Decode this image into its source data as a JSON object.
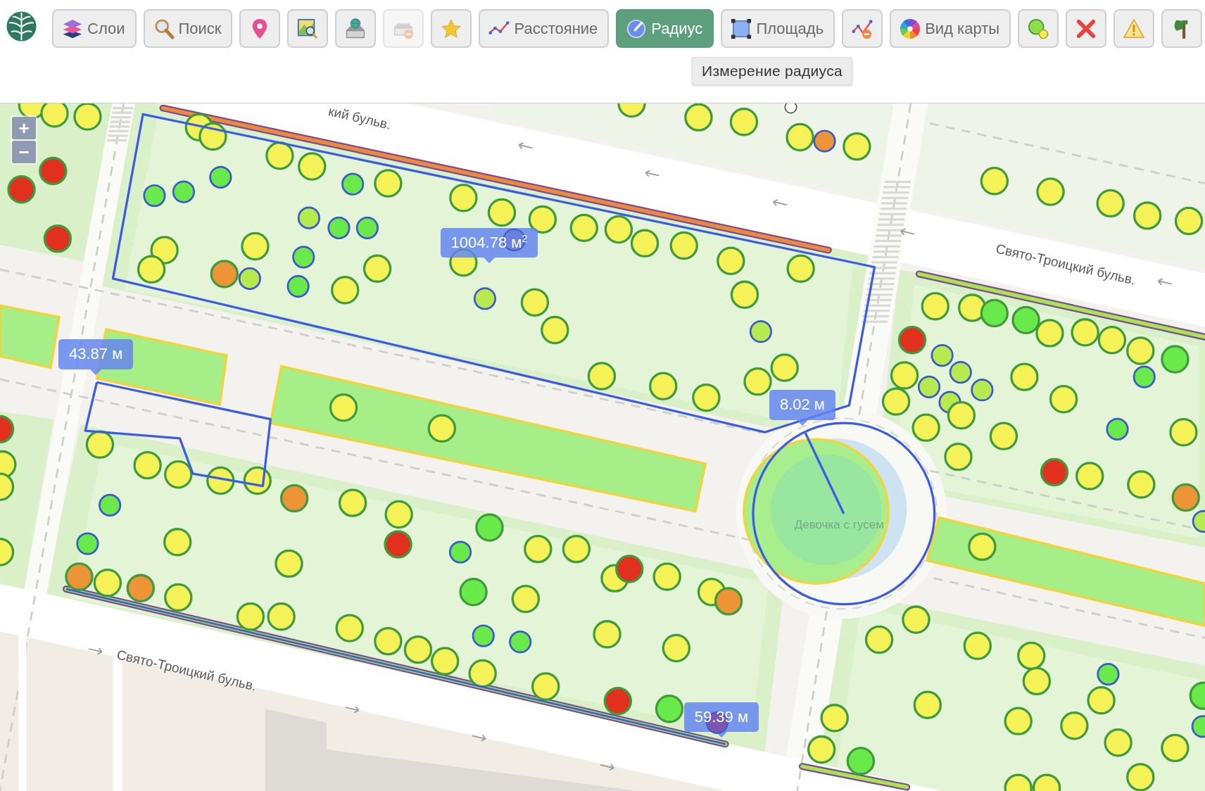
{
  "toolbar": {
    "buttons": [
      {
        "label": "Слои",
        "selected": false,
        "disabled": false
      },
      {
        "label": "Поиск",
        "selected": false,
        "disabled": false
      },
      {
        "selected": false,
        "disabled": false
      },
      {
        "selected": false,
        "disabled": false
      },
      {
        "selected": false,
        "disabled": false
      },
      {
        "selected": false,
        "disabled": true
      },
      {
        "selected": false,
        "disabled": false
      },
      {
        "label": "Расстояние",
        "selected": false,
        "disabled": false
      },
      {
        "label": "Радиус",
        "selected": true,
        "disabled": false
      },
      {
        "label": "Площадь",
        "selected": false,
        "disabled": false
      },
      {
        "selected": false,
        "disabled": false
      },
      {
        "label": "Вид карты",
        "selected": false,
        "disabled": false
      },
      {
        "selected": false,
        "disabled": false
      },
      {
        "selected": false,
        "disabled": false
      },
      {
        "selected": false,
        "disabled": false
      },
      {
        "selected": false,
        "disabled": false
      }
    ]
  },
  "tooltip": {
    "text": "Измерение радиуса"
  },
  "map": {
    "zoom_controls": [
      "+",
      "−"
    ],
    "street_labels": [
      "кий бульв.",
      "Свято-Троицкий бульв.",
      "Свято-Троицкий бульв."
    ],
    "place_label": "Девочка с гусем",
    "measurements": [
      {
        "kind": "area",
        "label": "1004.78 м$^{2}$"
      },
      {
        "kind": "distance",
        "label": "43.87 м"
      },
      {
        "kind": "radius",
        "label": "8.02 м"
      },
      {
        "kind": "distance",
        "label": "59.39 м"
      }
    ],
    "markers": [
      {
        "kind": "large",
        "color": "#f4f257"
      },
      {
        "kind": "large",
        "color": "#f4f257"
      },
      {
        "kind": "large",
        "color": "#f4f257"
      },
      {
        "kind": "large",
        "color": "#e2301f"
      },
      {
        "kind": "large",
        "color": "#e2301f"
      },
      {
        "kind": "large",
        "color": "#e2301f"
      },
      {
        "kind": "large",
        "color": "#e2301f"
      },
      {
        "kind": "large",
        "color": "#f4f257"
      },
      {
        "kind": "large",
        "color": "#f4f257"
      },
      {
        "kind": "large",
        "color": "#f4f257"
      },
      {
        "kind": "large",
        "color": "#f4f257"
      },
      {
        "kind": "large",
        "color": "#f4f257"
      },
      {
        "kind": "large",
        "color": "#f4f257"
      },
      {
        "kind": "large",
        "color": "#f4f257"
      },
      {
        "kind": "large",
        "color": "#f4f257"
      },
      {
        "kind": "large",
        "color": "#ec9436"
      },
      {
        "kind": "small",
        "color": "#6aea4a"
      },
      {
        "kind": "small",
        "color": "#6aea4a"
      },
      {
        "kind": "large",
        "color": "#f4f257"
      },
      {
        "kind": "large",
        "color": "#ec9436"
      },
      {
        "kind": "large",
        "color": "#f4f257"
      },
      {
        "kind": "large",
        "color": "#ec9436"
      },
      {
        "kind": "large",
        "color": "#f4f257"
      },
      {
        "kind": "large",
        "color": "#f4f257"
      },
      {
        "kind": "large",
        "color": "#f4f257"
      },
      {
        "kind": "large",
        "color": "#f4f257"
      },
      {
        "kind": "large",
        "color": "#f4f257"
      },
      {
        "kind": "large",
        "color": "#f4f257"
      },
      {
        "kind": "large",
        "color": "#e2301f"
      },
      {
        "kind": "large",
        "color": "#6aea4a"
      },
      {
        "kind": "small",
        "color": "#6aea4a"
      },
      {
        "kind": "large",
        "color": "#f4f257"
      },
      {
        "kind": "large",
        "color": "#f4f257"
      },
      {
        "kind": "large",
        "color": "#6aea4a"
      },
      {
        "kind": "large",
        "color": "#f4f257"
      },
      {
        "kind": "large",
        "color": "#f4f257"
      },
      {
        "kind": "large",
        "color": "#f4f257"
      },
      {
        "kind": "large",
        "color": "#f4f257"
      },
      {
        "kind": "large",
        "color": "#f4f257"
      },
      {
        "kind": "large",
        "color": "#f4f257"
      },
      {
        "kind": "small",
        "color": "#6aea4a"
      },
      {
        "kind": "small",
        "color": "#6aea4a"
      },
      {
        "kind": "large",
        "color": "#f4f257"
      },
      {
        "kind": "large",
        "color": "#f4f257"
      },
      {
        "kind": "large",
        "color": "#f4f257"
      },
      {
        "kind": "large",
        "color": "#e2301f"
      },
      {
        "kind": "large",
        "color": "#6aea4a"
      },
      {
        "kind": "small",
        "color": "#7b55b2"
      },
      {
        "kind": "large",
        "color": "#f4f257"
      },
      {
        "kind": "large",
        "color": "#e2301f"
      },
      {
        "kind": "large",
        "color": "#f4f257"
      },
      {
        "kind": "large",
        "color": "#f4f257"
      },
      {
        "kind": "large",
        "color": "#ec9436"
      },
      {
        "kind": "large",
        "color": "#f4f257"
      },
      {
        "kind": "large",
        "color": "#f4f257"
      },
      {
        "kind": "large",
        "color": "#f4f257"
      },
      {
        "kind": "large",
        "color": "#f4f257"
      },
      {
        "kind": "large",
        "color": "#f4f257"
      },
      {
        "kind": "large",
        "color": "#f4f257"
      },
      {
        "kind": "small",
        "color": "#6aea4a"
      },
      {
        "kind": "small",
        "color": "#6aea4a"
      },
      {
        "kind": "small",
        "color": "#6aea4a"
      },
      {
        "kind": "small",
        "color": "#6aea4a"
      },
      {
        "kind": "large",
        "color": "#f4f257"
      },
      {
        "kind": "small",
        "color": "#b6ea4e"
      },
      {
        "kind": "small",
        "color": "#6aea4a"
      },
      {
        "kind": "small",
        "color": "#6aea4a"
      },
      {
        "kind": "large",
        "color": "#f4f257"
      },
      {
        "kind": "large",
        "color": "#f4f257"
      },
      {
        "kind": "large",
        "color": "#ec9436"
      },
      {
        "kind": "small",
        "color": "#b6ea4e"
      },
      {
        "kind": "large",
        "color": "#f4f257"
      },
      {
        "kind": "small",
        "color": "#6aea4a"
      },
      {
        "kind": "small",
        "color": "#6aea4a"
      },
      {
        "kind": "large",
        "color": "#f4f257"
      },
      {
        "kind": "large",
        "color": "#f4f257"
      },
      {
        "kind": "large",
        "color": "#f4f257"
      },
      {
        "kind": "large",
        "color": "#f4f257"
      },
      {
        "kind": "large",
        "color": "#f4f257"
      },
      {
        "kind": "small",
        "color": "#6a80dc"
      },
      {
        "kind": "large",
        "color": "#f4f257"
      },
      {
        "kind": "small",
        "color": "#b6ea4e"
      },
      {
        "kind": "large",
        "color": "#f4f257"
      },
      {
        "kind": "large",
        "color": "#f4f257"
      },
      {
        "kind": "large",
        "color": "#f4f257"
      },
      {
        "kind": "large",
        "color": "#f4f257"
      },
      {
        "kind": "large",
        "color": "#f4f257"
      },
      {
        "kind": "large",
        "color": "#f4f257"
      },
      {
        "kind": "large",
        "color": "#f4f257"
      },
      {
        "kind": "large",
        "color": "#f4f257"
      },
      {
        "kind": "large",
        "color": "#f4f257"
      },
      {
        "kind": "small",
        "color": "#b6ea4e"
      },
      {
        "kind": "large",
        "color": "#f4f257"
      },
      {
        "kind": "large",
        "color": "#f4f257"
      },
      {
        "kind": "large",
        "color": "#f4f257"
      },
      {
        "kind": "large",
        "color": "#f4f257"
      },
      {
        "kind": "large",
        "color": "#f4f257"
      },
      {
        "kind": "large",
        "color": "#f4f257"
      },
      {
        "kind": "large",
        "color": "#f4f257"
      },
      {
        "kind": "large",
        "color": "#f4f257"
      },
      {
        "kind": "tiny",
        "color": "#ffffff"
      },
      {
        "kind": "large",
        "color": "#f4f257"
      },
      {
        "kind": "small",
        "color": "#ec9436"
      },
      {
        "kind": "large",
        "color": "#f4f257"
      },
      {
        "kind": "large",
        "color": "#f4f257"
      },
      {
        "kind": "large",
        "color": "#f4f257"
      },
      {
        "kind": "large",
        "color": "#f4f257"
      },
      {
        "kind": "large",
        "color": "#f4f257"
      },
      {
        "kind": "large",
        "color": "#f4f257"
      },
      {
        "kind": "large",
        "color": "#f4f257"
      },
      {
        "kind": "large",
        "color": "#f4f257"
      },
      {
        "kind": "large",
        "color": "#6aea4a"
      },
      {
        "kind": "large",
        "color": "#6aea4a"
      },
      {
        "kind": "large",
        "color": "#f4f257"
      },
      {
        "kind": "large",
        "color": "#f4f257"
      },
      {
        "kind": "large",
        "color": "#f4f257"
      },
      {
        "kind": "large",
        "color": "#f4f257"
      },
      {
        "kind": "large",
        "color": "#6aea4a"
      },
      {
        "kind": "large",
        "color": "#e2301f"
      },
      {
        "kind": "small",
        "color": "#b6ea4e"
      },
      {
        "kind": "small",
        "color": "#b6ea4e"
      },
      {
        "kind": "small",
        "color": "#b6ea4e"
      },
      {
        "kind": "large",
        "color": "#f4f257"
      },
      {
        "kind": "small",
        "color": "#b6ea4e"
      },
      {
        "kind": "small",
        "color": "#b6ea4e"
      },
      {
        "kind": "large",
        "color": "#f4f257"
      },
      {
        "kind": "large",
        "color": "#f4f257"
      },
      {
        "kind": "large",
        "color": "#f4f257"
      },
      {
        "kind": "large",
        "color": "#f4f257"
      },
      {
        "kind": "small",
        "color": "#6aea4a"
      },
      {
        "kind": "large",
        "color": "#f4f257"
      },
      {
        "kind": "large",
        "color": "#f4f257"
      },
      {
        "kind": "small",
        "color": "#6aea4a"
      },
      {
        "kind": "large",
        "color": "#f4f257"
      },
      {
        "kind": "large",
        "color": "#f4f257"
      },
      {
        "kind": "large",
        "color": "#e2301f"
      },
      {
        "kind": "large",
        "color": "#f4f257"
      },
      {
        "kind": "large",
        "color": "#f4f257"
      },
      {
        "kind": "large",
        "color": "#ec9436"
      },
      {
        "kind": "small",
        "color": "#b6ea4e"
      },
      {
        "kind": "large",
        "color": "#f4f257"
      },
      {
        "kind": "large",
        "color": "#f4f257"
      },
      {
        "kind": "large",
        "color": "#f4f257"
      },
      {
        "kind": "large",
        "color": "#f4f257"
      },
      {
        "kind": "large",
        "color": "#f4f257"
      },
      {
        "kind": "large",
        "color": "#f4f257"
      },
      {
        "kind": "small",
        "color": "#6aea4a"
      },
      {
        "kind": "large",
        "color": "#f4f257"
      },
      {
        "kind": "large",
        "color": "#6aea4a"
      },
      {
        "kind": "large",
        "color": "#f4f257"
      },
      {
        "kind": "large",
        "color": "#f4f257"
      },
      {
        "kind": "large",
        "color": "#f4f257"
      },
      {
        "kind": "large",
        "color": "#f4f257"
      },
      {
        "kind": "large",
        "color": "#f4f257"
      },
      {
        "kind": "small",
        "color": "#6aea4a"
      },
      {
        "kind": "large",
        "color": "#f4f257"
      },
      {
        "kind": "large",
        "color": "#f4f257"
      },
      {
        "kind": "large",
        "color": "#6aea4a"
      },
      {
        "kind": "large",
        "color": "#f4f257"
      },
      {
        "kind": "large",
        "color": "#f4f257"
      },
      {
        "kind": "large",
        "color": "#f4f257"
      }
    ]
  }
}
